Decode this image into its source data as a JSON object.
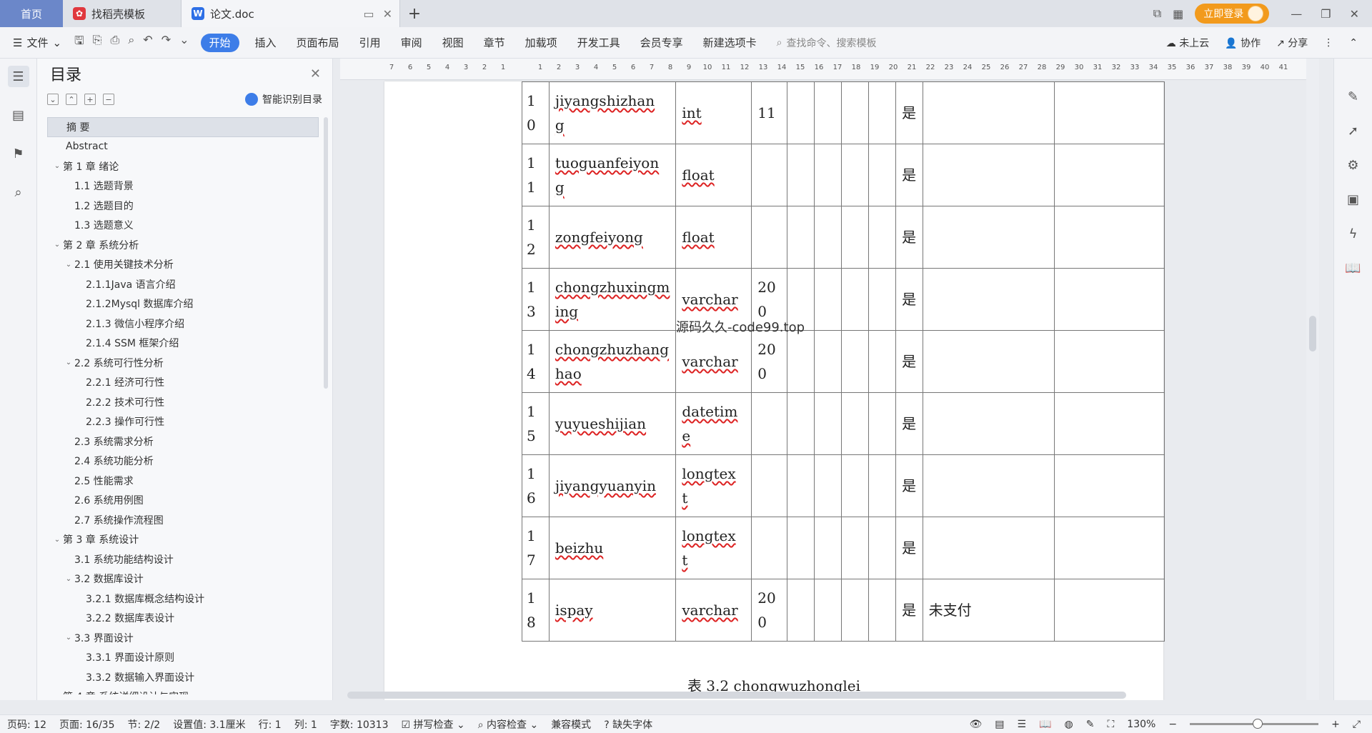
{
  "tabs": {
    "home": "首页",
    "docer": "找稻壳模板",
    "doc": "论文.doc"
  },
  "titlebar": {
    "login": "立即登录"
  },
  "menubar": {
    "file": "文件",
    "items": [
      "开始",
      "插入",
      "页面布局",
      "引用",
      "审阅",
      "视图",
      "章节",
      "加载项",
      "开发工具",
      "会员专享",
      "新建选项卡"
    ],
    "search_placeholder": "查找命令、搜索模板",
    "cloud": "未上云",
    "collab": "协作",
    "share": "分享"
  },
  "toc": {
    "title": "目录",
    "smart": "智能识别目录",
    "items": [
      {
        "label": "摘  要",
        "level": 0,
        "arrow": false,
        "selected": true
      },
      {
        "label": "Abstract",
        "level": 0,
        "arrow": false
      },
      {
        "label": "第 1 章   绪论",
        "level": 0,
        "arrow": true
      },
      {
        "label": "1.1 选题背景",
        "level": 1,
        "arrow": false
      },
      {
        "label": "1.2 选题目的",
        "level": 1,
        "arrow": false
      },
      {
        "label": "1.3 选题意义",
        "level": 1,
        "arrow": false
      },
      {
        "label": "第 2 章  系统分析",
        "level": 0,
        "arrow": true
      },
      {
        "label": "2.1 使用关键技术分析",
        "level": 1,
        "arrow": true
      },
      {
        "label": "2.1.1Java 语言介绍",
        "level": 2,
        "arrow": false
      },
      {
        "label": " 2.1.2Mysql 数据库介绍",
        "level": 2,
        "arrow": false
      },
      {
        "label": "2.1.3 微信小程序介绍",
        "level": 2,
        "arrow": false
      },
      {
        "label": "2.1.4 SSM 框架介绍",
        "level": 2,
        "arrow": false
      },
      {
        "label": "2.2 系统可行性分析",
        "level": 1,
        "arrow": true
      },
      {
        "label": "2.2.1 经济可行性",
        "level": 2,
        "arrow": false
      },
      {
        "label": "2.2.2 技术可行性",
        "level": 2,
        "arrow": false
      },
      {
        "label": "2.2.3 操作可行性",
        "level": 2,
        "arrow": false
      },
      {
        "label": "2.3 系统需求分析",
        "level": 1,
        "arrow": false
      },
      {
        "label": "2.4 系统功能分析",
        "level": 1,
        "arrow": false
      },
      {
        "label": "2.5 性能需求",
        "level": 1,
        "arrow": false
      },
      {
        "label": "2.6 系统用例图",
        "level": 1,
        "arrow": false
      },
      {
        "label": "2.7 系统操作流程图",
        "level": 1,
        "arrow": false
      },
      {
        "label": "第 3 章  系统设计",
        "level": 0,
        "arrow": true
      },
      {
        "label": "3.1 系统功能结构设计",
        "level": 1,
        "arrow": false
      },
      {
        "label": "3.2 数据库设计",
        "level": 1,
        "arrow": true
      },
      {
        "label": "3.2.1 数据库概念结构设计",
        "level": 2,
        "arrow": false
      },
      {
        "label": "3.2.2 数据库表设计",
        "level": 2,
        "arrow": false
      },
      {
        "label": "3.3 界面设计",
        "level": 1,
        "arrow": true
      },
      {
        "label": "3.3.1 界面设计原则",
        "level": 2,
        "arrow": false
      },
      {
        "label": "3.3.2 数据输入界面设计",
        "level": 2,
        "arrow": false
      },
      {
        "label": "第 4 章  系统详细设计与实现",
        "level": 0,
        "arrow": true
      }
    ]
  },
  "ruler_ticks": [
    "7",
    "6",
    "5",
    "4",
    "3",
    "2",
    "1",
    "",
    "1",
    "2",
    "3",
    "4",
    "5",
    "6",
    "7",
    "8",
    "9",
    "10",
    "11",
    "12",
    "13",
    "14",
    "15",
    "16",
    "17",
    "18",
    "19",
    "20",
    "21",
    "22",
    "23",
    "24",
    "25",
    "26",
    "27",
    "28",
    "29",
    "30",
    "31",
    "32",
    "33",
    "34",
    "35",
    "36",
    "37",
    "38",
    "39",
    "40",
    "41"
  ],
  "table": {
    "rows": [
      {
        "no": "1\n0",
        "name": "jiyangshizhan\ng",
        "type": "int",
        "len": "11",
        "nul": "是",
        "remark": ""
      },
      {
        "no": "1\n1",
        "name": "tuoguanfeiyon\ng",
        "type": "float",
        "len": "",
        "nul": "是",
        "remark": ""
      },
      {
        "no": "1\n2",
        "name": "zongfeiyong",
        "type": "float",
        "len": "",
        "nul": "是",
        "remark": ""
      },
      {
        "no": "1\n3",
        "name": "chongzhuxingm\ning",
        "type": "varchar",
        "len": "20\n0",
        "nul": "是",
        "remark": ""
      },
      {
        "no": "1\n4",
        "name": "chongzhuzhang\nhao",
        "type": "varchar",
        "len": "20\n0",
        "nul": "是",
        "remark": ""
      },
      {
        "no": "1\n5",
        "name": "yuyueshijian",
        "type": "datetim\ne",
        "len": "",
        "nul": "是",
        "remark": ""
      },
      {
        "no": "1\n6",
        "name": "jiyangyuanyin",
        "type": "longtex\nt",
        "len": "",
        "nul": "是",
        "remark": ""
      },
      {
        "no": "1\n7",
        "name": "beizhu",
        "type": "longtex\nt",
        "len": "",
        "nul": "是",
        "remark": ""
      },
      {
        "no": "1\n8",
        "name": "ispay",
        "type": "varchar",
        "len": "20\n0",
        "nul": "是",
        "remark": "未支付"
      }
    ],
    "watermark": "源码久久-code99.top",
    "caption": "表 3.2 chongwuzhonglei"
  },
  "statusbar": {
    "page": "页码: 12",
    "pages": "页面: 16/35",
    "section": "节: 2/2",
    "setting": "设置值: 3.1厘米",
    "line": "行: 1",
    "col": "列: 1",
    "words": "字数: 10313",
    "spell": "拼写检查",
    "content_check": "内容检查",
    "compat": "兼容模式",
    "missing_font": "缺失字体",
    "zoom": "130%"
  }
}
